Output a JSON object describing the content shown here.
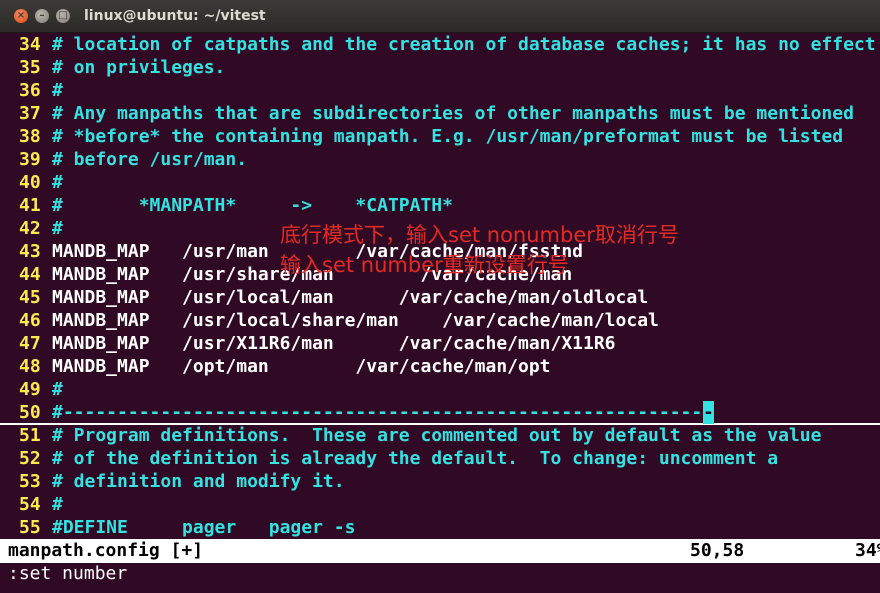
{
  "window": {
    "title": "linux@ubuntu: ~/vitest",
    "close_glyph": "×",
    "minimize_glyph": "–",
    "maximize_glyph": "□"
  },
  "editor": {
    "lines": [
      {
        "n": "34",
        "text": "# location of catpaths and the creation of database caches; it has no effect",
        "style": "comment"
      },
      {
        "n": "35",
        "text": "# on privileges.",
        "style": "comment"
      },
      {
        "n": "36",
        "text": "#",
        "style": "comment"
      },
      {
        "n": "37",
        "text": "# Any manpaths that are subdirectories of other manpaths must be mentioned",
        "style": "comment"
      },
      {
        "n": "38",
        "text": "# *before* the containing manpath. E.g. /usr/man/preformat must be listed",
        "style": "comment"
      },
      {
        "n": "39",
        "text": "# before /usr/man.",
        "style": "comment"
      },
      {
        "n": "40",
        "text": "#",
        "style": "comment"
      },
      {
        "n": "41",
        "text": "#       *MANPATH*     ->    *CATPATH*",
        "style": "comment"
      },
      {
        "n": "42",
        "text": "#",
        "style": "comment"
      },
      {
        "n": "43",
        "text": "MANDB_MAP   /usr/man        /var/cache/man/fsstnd",
        "style": "normal"
      },
      {
        "n": "44",
        "text": "MANDB_MAP   /usr/share/man        /var/cache/man",
        "style": "normal"
      },
      {
        "n": "45",
        "text": "MANDB_MAP   /usr/local/man      /var/cache/man/oldlocal",
        "style": "normal"
      },
      {
        "n": "46",
        "text": "MANDB_MAP   /usr/local/share/man    /var/cache/man/local",
        "style": "normal"
      },
      {
        "n": "47",
        "text": "MANDB_MAP   /usr/X11R6/man      /var/cache/man/X11R6",
        "style": "normal"
      },
      {
        "n": "48",
        "text": "MANDB_MAP   /opt/man        /var/cache/man/opt",
        "style": "normal"
      },
      {
        "n": "49",
        "text": "#",
        "style": "comment"
      },
      {
        "n": "50",
        "text": "#-----------------------------------------------------------",
        "cursor_char": "-",
        "style": "comment"
      },
      {
        "n": "51",
        "text": "# Program definitions.  These are commented out by default as the value",
        "style": "comment"
      },
      {
        "n": "52",
        "text": "# of the definition is already the default.  To change: uncomment a",
        "style": "comment"
      },
      {
        "n": "53",
        "text": "# definition and modify it.",
        "style": "comment"
      },
      {
        "n": "54",
        "text": "#",
        "style": "comment"
      },
      {
        "n": "55",
        "text": "#DEFINE     pager   pager -s",
        "style": "comment"
      }
    ]
  },
  "annotation": {
    "line1": "底行模式下，输入set nonumber取消行号",
    "line2": "输入set number重新设置行号"
  },
  "status": {
    "file": "manpath.config [+]",
    "position": "50,58",
    "percent": "34%"
  },
  "command": ":set number",
  "colors": {
    "background": "#300a24",
    "line_number": "#fce94f",
    "comment": "#34e2e2",
    "annotation": "#e42a25"
  }
}
